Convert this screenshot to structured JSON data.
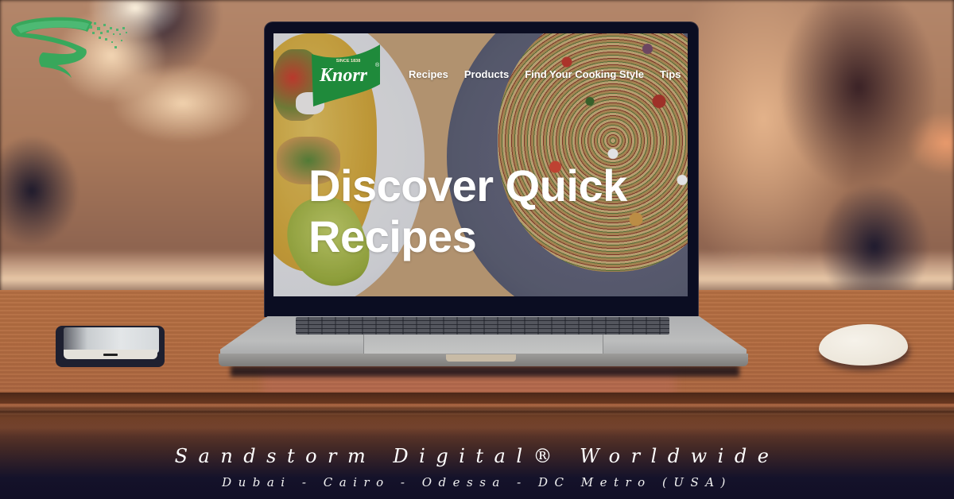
{
  "brand": {
    "name": "Sandstorm Digital® Worldwide",
    "locations": "Dubai - Cairo - Odessa - DC Metro (USA)",
    "logo_icon": "sandstorm-swirl-logo",
    "logo_color": "#2eaa5a"
  },
  "laptop_site": {
    "logo": {
      "text": "Knorr",
      "tagline": "SINCE 1838",
      "registered_mark": "®",
      "color": "#1f8a3b"
    },
    "nav": [
      {
        "label": "Recipes"
      },
      {
        "label": "Products"
      },
      {
        "label": "Find Your Cooking Style"
      },
      {
        "label": "Tips"
      }
    ],
    "hero": {
      "line1": "Discover Quick",
      "line2": "Recipes"
    }
  },
  "scene": {
    "objects": [
      "smartphone",
      "laptop",
      "mouse",
      "wooden-desk"
    ]
  }
}
